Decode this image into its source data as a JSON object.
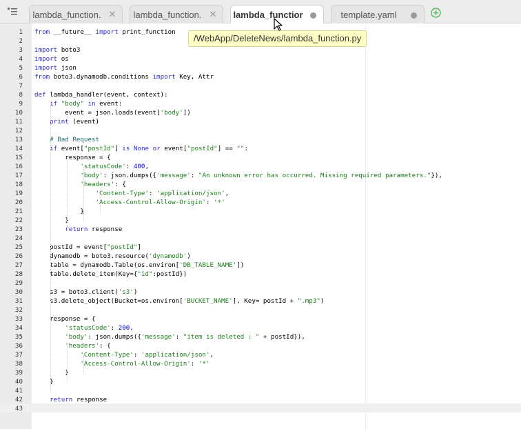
{
  "tabs": [
    {
      "label": "lambda_function.",
      "state": "close",
      "active": false
    },
    {
      "label": "lambda_function.",
      "state": "close",
      "active": false
    },
    {
      "label": "lambda_functior",
      "state": "modified",
      "active": true
    },
    {
      "label": "template.yaml",
      "state": "modified",
      "active": false
    }
  ],
  "tooltip": "/WebApp/DeleteNews/lambda_function.py",
  "editor": {
    "active_line": 43,
    "lines": [
      {
        "n": 1,
        "segs": [
          [
            "kw",
            "from"
          ],
          [
            "t",
            " __future__ "
          ],
          [
            "kw",
            "import"
          ],
          [
            "t",
            " print_function"
          ]
        ]
      },
      {
        "n": 2,
        "segs": []
      },
      {
        "n": 3,
        "segs": [
          [
            "kw",
            "import"
          ],
          [
            "t",
            " boto3"
          ]
        ]
      },
      {
        "n": 4,
        "segs": [
          [
            "kw",
            "import"
          ],
          [
            "t",
            " os"
          ]
        ]
      },
      {
        "n": 5,
        "segs": [
          [
            "kw",
            "import"
          ],
          [
            "t",
            " json"
          ]
        ]
      },
      {
        "n": 6,
        "segs": [
          [
            "kw",
            "from"
          ],
          [
            "t",
            " boto3.dynamodb.conditions "
          ],
          [
            "kw",
            "import"
          ],
          [
            "t",
            " Key, Attr"
          ]
        ]
      },
      {
        "n": 7,
        "segs": []
      },
      {
        "n": 8,
        "segs": [
          [
            "kw",
            "def"
          ],
          [
            "t",
            " lambda_handler(event, context):"
          ]
        ]
      },
      {
        "n": 9,
        "segs": [
          [
            "t",
            "    "
          ],
          [
            "kw",
            "if"
          ],
          [
            "t",
            " "
          ],
          [
            "str",
            "\"body\""
          ],
          [
            "t",
            " "
          ],
          [
            "kw",
            "in"
          ],
          [
            "t",
            " event:"
          ]
        ]
      },
      {
        "n": 10,
        "segs": [
          [
            "t",
            "        event = json.loads(event["
          ],
          [
            "str",
            "'body'"
          ],
          [
            "t",
            "])"
          ]
        ]
      },
      {
        "n": 11,
        "segs": [
          [
            "t",
            "    "
          ],
          [
            "kw",
            "print"
          ],
          [
            "t",
            " (event)"
          ]
        ]
      },
      {
        "n": 12,
        "segs": []
      },
      {
        "n": 13,
        "segs": [
          [
            "t",
            "    "
          ],
          [
            "cmt",
            "# Bad Request"
          ]
        ]
      },
      {
        "n": 14,
        "segs": [
          [
            "t",
            "    "
          ],
          [
            "kw",
            "if"
          ],
          [
            "t",
            " event["
          ],
          [
            "str",
            "\"postId\""
          ],
          [
            "t",
            "] "
          ],
          [
            "kw",
            "is"
          ],
          [
            "t",
            " "
          ],
          [
            "kw",
            "None"
          ],
          [
            "t",
            " "
          ],
          [
            "kw",
            "or"
          ],
          [
            "t",
            " event["
          ],
          [
            "str",
            "\"postId\""
          ],
          [
            "t",
            "] == "
          ],
          [
            "str",
            "\"\""
          ],
          [
            "t",
            ":"
          ]
        ]
      },
      {
        "n": 15,
        "segs": [
          [
            "t",
            "        response = {"
          ]
        ]
      },
      {
        "n": 16,
        "segs": [
          [
            "t",
            "            "
          ],
          [
            "str",
            "'statusCode'"
          ],
          [
            "t",
            ": "
          ],
          [
            "num",
            "400"
          ],
          [
            "t",
            ","
          ]
        ]
      },
      {
        "n": 17,
        "segs": [
          [
            "t",
            "            "
          ],
          [
            "str",
            "'body'"
          ],
          [
            "t",
            ": json.dumps({"
          ],
          [
            "str",
            "'message'"
          ],
          [
            "t",
            ": "
          ],
          [
            "str",
            "\"An unknown error has occurred. Missing required parameters.\""
          ],
          [
            "t",
            "}),"
          ]
        ]
      },
      {
        "n": 18,
        "segs": [
          [
            "t",
            "            "
          ],
          [
            "str",
            "'headers'"
          ],
          [
            "t",
            ": {"
          ]
        ]
      },
      {
        "n": 19,
        "segs": [
          [
            "t",
            "                "
          ],
          [
            "str",
            "'Content-Type'"
          ],
          [
            "t",
            ": "
          ],
          [
            "str",
            "'application/json'"
          ],
          [
            "t",
            ","
          ]
        ]
      },
      {
        "n": 20,
        "segs": [
          [
            "t",
            "                "
          ],
          [
            "str",
            "'Access-Control-Allow-Origin'"
          ],
          [
            "t",
            ": "
          ],
          [
            "str",
            "'*'"
          ]
        ]
      },
      {
        "n": 21,
        "segs": [
          [
            "t",
            "            }"
          ]
        ]
      },
      {
        "n": 22,
        "segs": [
          [
            "t",
            "        }"
          ]
        ]
      },
      {
        "n": 23,
        "segs": [
          [
            "t",
            "        "
          ],
          [
            "kw",
            "return"
          ],
          [
            "t",
            " response"
          ]
        ]
      },
      {
        "n": 24,
        "segs": []
      },
      {
        "n": 25,
        "segs": [
          [
            "t",
            "    postId = event["
          ],
          [
            "str",
            "\"postId\""
          ],
          [
            "t",
            "]"
          ]
        ]
      },
      {
        "n": 26,
        "segs": [
          [
            "t",
            "    dynamodb = boto3.resource("
          ],
          [
            "str",
            "'dynamodb'"
          ],
          [
            "t",
            ")"
          ]
        ]
      },
      {
        "n": 27,
        "segs": [
          [
            "t",
            "    table = dynamodb.Table(os.environ["
          ],
          [
            "str",
            "'DB_TABLE_NAME'"
          ],
          [
            "t",
            "])"
          ]
        ]
      },
      {
        "n": 28,
        "segs": [
          [
            "t",
            "    table.delete_item(Key={"
          ],
          [
            "str",
            "\"id\""
          ],
          [
            "t",
            ":postId})"
          ]
        ]
      },
      {
        "n": 29,
        "segs": []
      },
      {
        "n": 30,
        "segs": [
          [
            "t",
            "    s3 = boto3.client("
          ],
          [
            "str",
            "'s3'"
          ],
          [
            "t",
            ")"
          ]
        ]
      },
      {
        "n": 31,
        "segs": [
          [
            "t",
            "    s3.delete_object(Bucket=os.environ["
          ],
          [
            "str",
            "'BUCKET_NAME'"
          ],
          [
            "t",
            "], Key= postId + "
          ],
          [
            "str",
            "\".mp3\""
          ],
          [
            "t",
            ")"
          ]
        ]
      },
      {
        "n": 32,
        "segs": []
      },
      {
        "n": 33,
        "segs": [
          [
            "t",
            "    response = {"
          ]
        ]
      },
      {
        "n": 34,
        "segs": [
          [
            "t",
            "        "
          ],
          [
            "str",
            "'statusCode'"
          ],
          [
            "t",
            ": "
          ],
          [
            "num",
            "200"
          ],
          [
            "t",
            ","
          ]
        ]
      },
      {
        "n": 35,
        "segs": [
          [
            "t",
            "        "
          ],
          [
            "str",
            "'body'"
          ],
          [
            "t",
            ": json.dumps({"
          ],
          [
            "str",
            "'message'"
          ],
          [
            "t",
            ": "
          ],
          [
            "str",
            "\"item is deleted : \""
          ],
          [
            "t",
            " + postId}),"
          ]
        ]
      },
      {
        "n": 36,
        "segs": [
          [
            "t",
            "        "
          ],
          [
            "str",
            "'headers'"
          ],
          [
            "t",
            ": {"
          ]
        ]
      },
      {
        "n": 37,
        "segs": [
          [
            "t",
            "            "
          ],
          [
            "str",
            "'Content-Type'"
          ],
          [
            "t",
            ": "
          ],
          [
            "str",
            "'application/json'"
          ],
          [
            "t",
            ","
          ]
        ]
      },
      {
        "n": 38,
        "segs": [
          [
            "t",
            "            "
          ],
          [
            "str",
            "'Access-Control-Allow-Origin'"
          ],
          [
            "t",
            ": "
          ],
          [
            "str",
            "'*'"
          ]
        ]
      },
      {
        "n": 39,
        "segs": [
          [
            "t",
            "        }"
          ]
        ]
      },
      {
        "n": 40,
        "segs": [
          [
            "t",
            "    }"
          ]
        ]
      },
      {
        "n": 41,
        "segs": []
      },
      {
        "n": 42,
        "segs": [
          [
            "t",
            "    "
          ],
          [
            "kw",
            "return"
          ],
          [
            "t",
            " response"
          ]
        ]
      },
      {
        "n": 43,
        "segs": []
      }
    ]
  },
  "icons": {
    "menu": "file-tree-menu-icon",
    "close": "close-icon",
    "modified": "unsaved-dot-icon",
    "add": "add-tab-icon",
    "cursor": "mouse-cursor-icon"
  },
  "colors": {
    "keyword": "#2a2ad6",
    "string": "#1a7d1a",
    "number": "#0000cd",
    "comment": "#236e74",
    "gutter": "#ebebeb",
    "tooltip": "#ffffc6",
    "add_icon": "#3cb043"
  }
}
